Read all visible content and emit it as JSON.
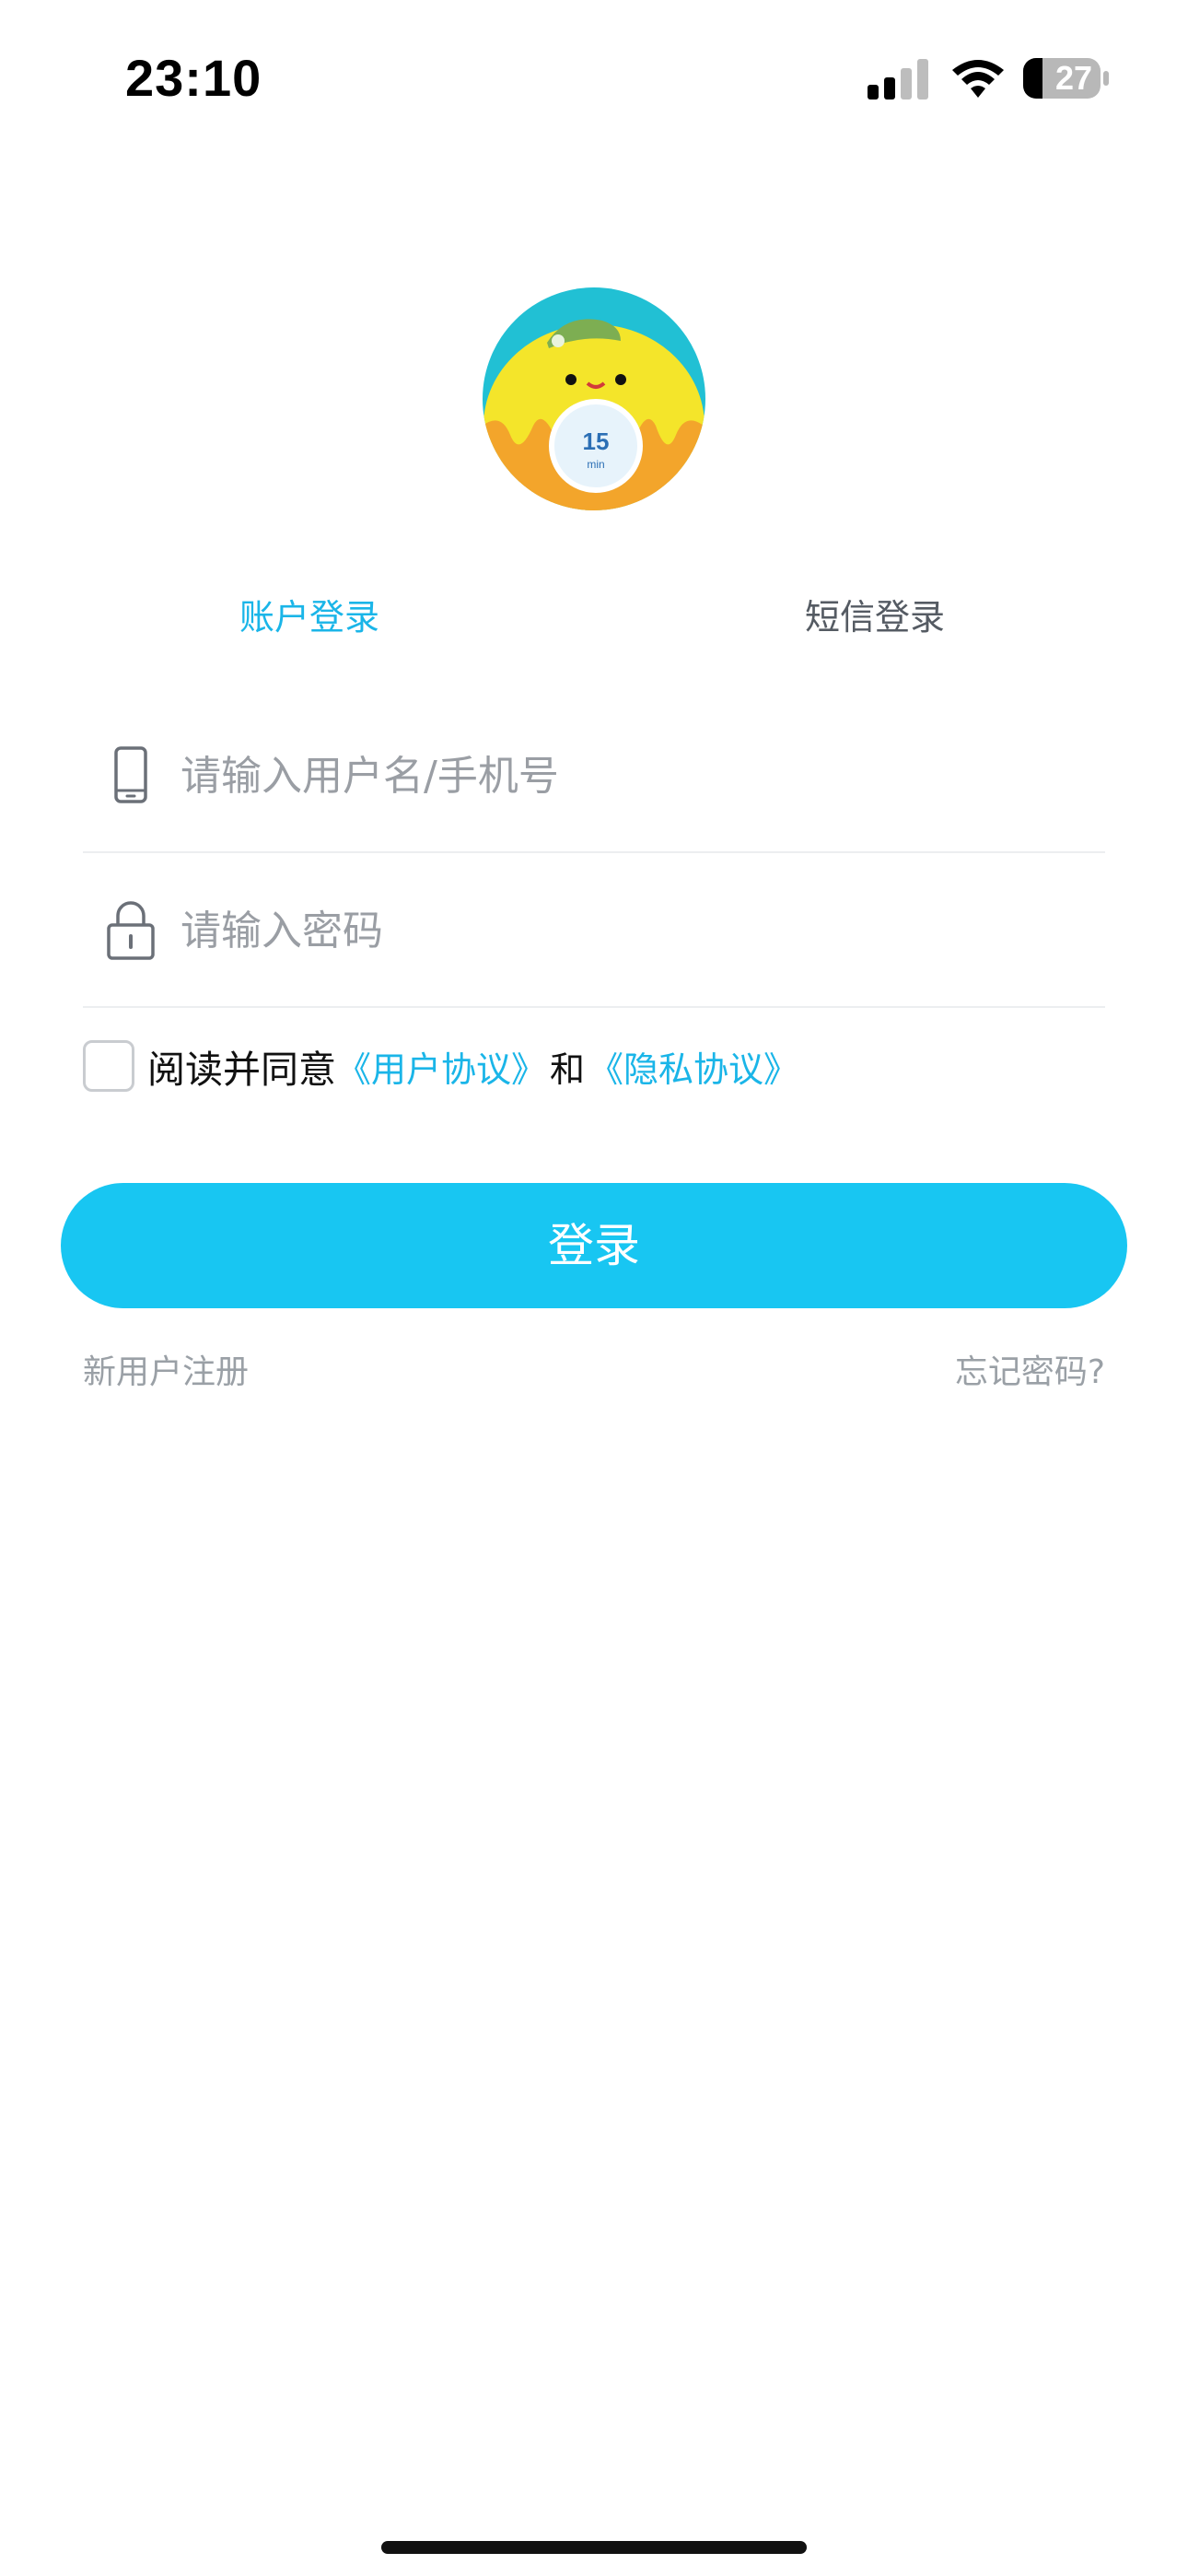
{
  "status_bar": {
    "time": "23:10",
    "battery_level": "27",
    "icons": [
      "signal-icon",
      "wifi-icon",
      "battery-icon"
    ]
  },
  "logo": {
    "icon": "app-logo-mascot",
    "badge_text": "15",
    "badge_subtext": "min"
  },
  "tabs": [
    {
      "label": "账户登录",
      "active": true
    },
    {
      "label": "短信登录",
      "active": false
    }
  ],
  "form": {
    "username": {
      "placeholder": "请输入用户名/手机号",
      "value": "",
      "icon": "phone-icon"
    },
    "password": {
      "placeholder": "请输入密码",
      "value": "",
      "icon": "lock-icon"
    }
  },
  "agreement": {
    "checked": false,
    "prefix": "阅读并同意",
    "user_agreement": "《用户协议》",
    "and": "和",
    "privacy_policy": "《隐私协议》"
  },
  "login_button": {
    "label": "登录"
  },
  "links": {
    "register": "新用户注册",
    "forgot_password": "忘记密码?"
  },
  "colors": {
    "accent": "#18c6f2",
    "tab_active": "#1ab5e8",
    "muted_text": "#9aa0a6"
  }
}
